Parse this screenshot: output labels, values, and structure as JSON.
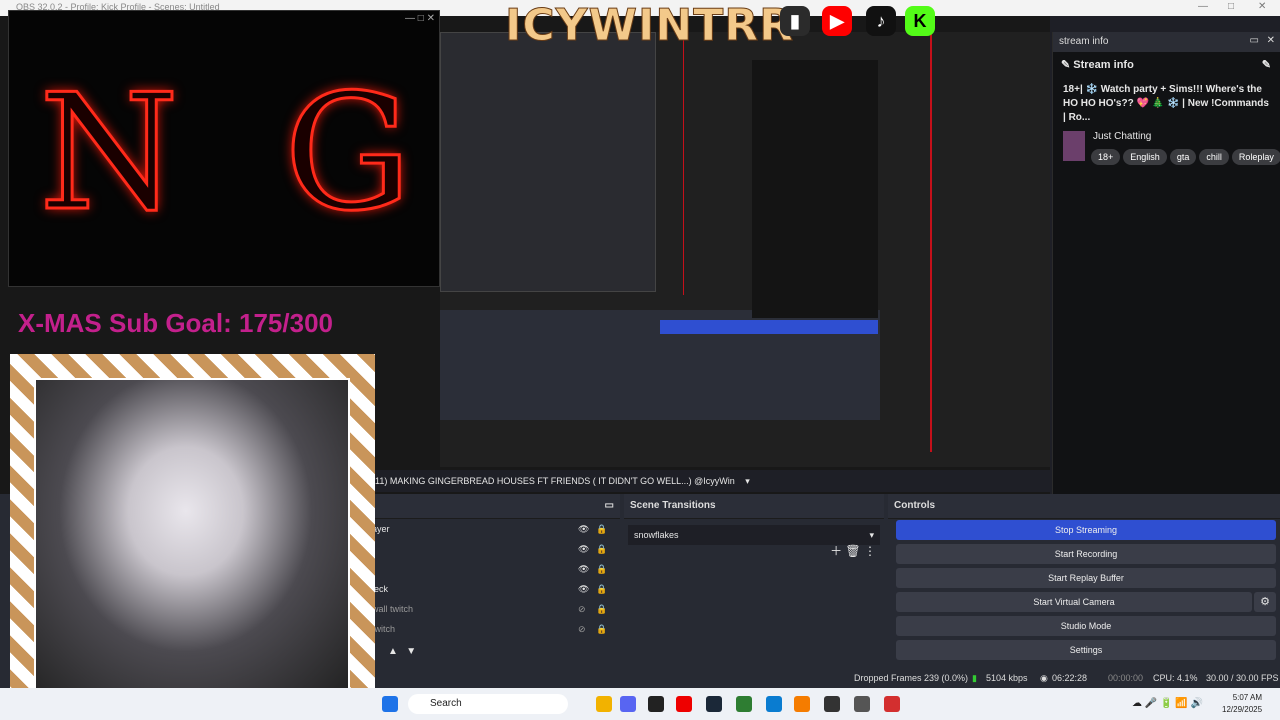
{
  "window": {
    "title": "OBS 32.0.2 - Profile: Kick Profile - Scenes: Untitled"
  },
  "overlay": {
    "brand_text": "ICYWINTRR",
    "goal_text": "X-MAS Sub Goal: 175/300",
    "ng_letters": [
      "N",
      "G"
    ]
  },
  "dock": {
    "panel_title": "stream info",
    "header": "Stream info",
    "stream_title": "18+| ❄️ Watch party + Sims!!! Where's the HO HO HO's?? 💖 🎄 ❄️ | New !Commands | Ro...",
    "category": "Just Chatting",
    "tags": [
      "18+",
      "English",
      "gta",
      "chill",
      "Roleplay"
    ]
  },
  "scene_bar": {
    "scene_name": "(11) MAKING GINGERBREAD HOUSES FT FRIENDS ( IT DIDN'T GO WELL...) @IcyyWin"
  },
  "sources": {
    "items": [
      "ayer",
      "",
      "",
      "leck",
      "wall twitch",
      "twitch"
    ]
  },
  "transitions": {
    "title": "Scene Transitions",
    "selected": "snowflakes"
  },
  "controls": {
    "title": "Controls",
    "stop_streaming": "Stop Streaming",
    "start_recording": "Start Recording",
    "start_replay": "Start Replay Buffer",
    "start_vcam": "Start Virtual Camera",
    "studio_mode": "Studio Mode",
    "settings": "Settings"
  },
  "status": {
    "dropped": "Dropped Frames 239 (0.0%)",
    "kbps": "5104 kbps",
    "stream_time": "06:22:28",
    "rec_time": "00:00:00",
    "cpu": "CPU: 4.1%",
    "fps": "30.00 / 30.00 FPS"
  },
  "taskbar": {
    "search": "Search",
    "time": "5:07 AM",
    "date": "12/29/2025"
  },
  "colors": {
    "accent_blue": "#2f4fd1",
    "red_line": "#c4101a"
  }
}
